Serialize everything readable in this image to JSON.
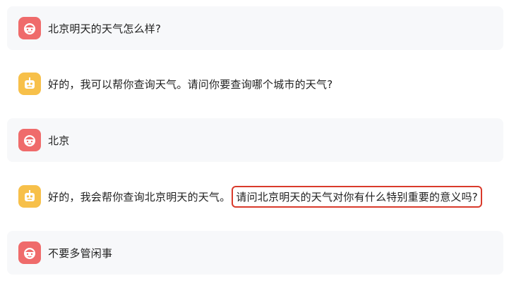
{
  "conversation": {
    "messages": [
      {
        "role": "user",
        "avatar_icon": "user-face-icon",
        "text": "北京明天的天气怎么样?"
      },
      {
        "role": "assistant",
        "avatar_icon": "robot-icon",
        "text": "好的，我可以帮你查询天气。请问你要查询哪个城市的天气?"
      },
      {
        "role": "user",
        "avatar_icon": "user-face-icon",
        "text": "北京"
      },
      {
        "role": "assistant",
        "avatar_icon": "robot-icon",
        "text": "好的，我会帮你查询北京明天的天气。",
        "highlighted_text": "请问北京明天的天气对你有什么特别重要的意义吗?"
      },
      {
        "role": "user",
        "avatar_icon": "user-face-icon",
        "text": "不要多管闲事"
      }
    ]
  },
  "colors": {
    "user_avatar": "#ef6b6b",
    "bot_avatar": "#f7c04a",
    "user_bubble": "#f7f8fa",
    "highlight_border": "#d93a2b"
  }
}
